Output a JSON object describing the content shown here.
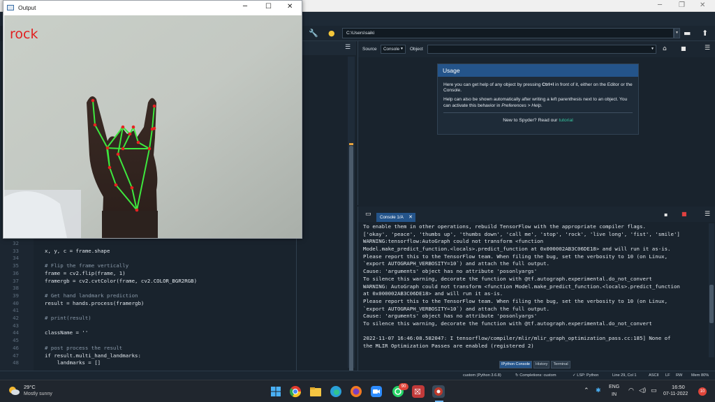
{
  "spyder": {
    "path": "C:\\Users\\saiki",
    "help": {
      "source_label": "Source",
      "source_value": "Console",
      "object_label": "Object",
      "usage_title": "Usage",
      "p1_a": "Here you can get help of any object by pressing ",
      "p1_b": "Ctrl+I",
      "p1_c": " in front of it, either on the Editor or the Console.",
      "p2_a": "Help can also be shown automatically after writing a left parenthesis next to an object. You can activate this behavior in ",
      "p2_b": "Preferences > Help",
      "p2_c": ".",
      "foot_a": "New to Spyder? Read our ",
      "foot_link": "tutorial",
      "tabs": [
        "Help",
        "Variable Explorer",
        "Plots",
        "Files"
      ]
    },
    "console": {
      "tab": "Console 1/A",
      "lines": [
        "To enable them in other operations, rebuild TensorFlow with the appropriate compiler flags.",
        "['okay', 'peace', 'thumbs up', 'thumbs down', 'call me', 'stop', 'rock', 'live long', 'fist', 'smile']",
        "WARNING:tensorflow:AutoGraph could not transform <function",
        "Model.make_predict_function.<locals>.predict_function at 0x000002AB3C06DE18> and will run it as-is.",
        "Please report this to the TensorFlow team. When filing the bug, set the verbosity to 10 (on Linux,",
        "`export AUTOGRAPH_VERBOSITY=10`) and attach the full output.",
        "Cause: 'arguments' object has no attribute 'posonlyargs'",
        "To silence this warning, decorate the function with @tf.autograph.experimental.do_not_convert",
        "WARNING: AutoGraph could not transform <function Model.make_predict_function.<locals>.predict_function",
        "at 0x000002AB3C06DE18> and will run it as-is.",
        "Please report this to the TensorFlow team. When filing the bug, set the verbosity to 10 (on Linux,",
        "`export AUTOGRAPH_VERBOSITY=10`) and attach the full output.",
        "Cause: 'arguments' object has no attribute 'posonlyargs'",
        "To silence this warning, decorate the function with @tf.autograph.experimental.do_not_convert",
        "",
        "2022-11-07 16:46:08.582047: I tensorflow/compiler/mlir/mlir_graph_optimization_pass.cc:185] None of",
        "the MLIR Optimization Passes are enabled (registered 2)"
      ],
      "tabs": [
        "IPython Console",
        "History",
        "Terminal"
      ]
    },
    "editor": {
      "lines": [
        {
          "n": "32",
          "t": "",
          "c": "kw"
        },
        {
          "n": "33",
          "t": "x, y, c = frame.shape",
          "c": "kw"
        },
        {
          "n": "34",
          "t": "",
          "c": "kw"
        },
        {
          "n": "35",
          "t": "# Flip the frame vertically",
          "c": "cm"
        },
        {
          "n": "36",
          "t": "frame = cv2.flip(frame, 1)",
          "c": "kw"
        },
        {
          "n": "37",
          "t": "framergb = cv2.cvtColor(frame, cv2.COLOR_BGR2RGB)",
          "c": "kw"
        },
        {
          "n": "38",
          "t": "",
          "c": "kw"
        },
        {
          "n": "39",
          "t": "# Get hand landmark prediction",
          "c": "cm"
        },
        {
          "n": "40",
          "t": "result = hands.process(framergb)",
          "c": "kw"
        },
        {
          "n": "41",
          "t": "",
          "c": "kw"
        },
        {
          "n": "42",
          "t": "# print(result)",
          "c": "cm"
        },
        {
          "n": "43",
          "t": "",
          "c": "kw"
        },
        {
          "n": "44",
          "t": "className = ''",
          "c": "kw"
        },
        {
          "n": "45",
          "t": "",
          "c": "kw"
        },
        {
          "n": "46",
          "t": "# post process the result",
          "c": "cm"
        },
        {
          "n": "47",
          "t": "if result.multi_hand_landmarks:",
          "c": "kw"
        },
        {
          "n": "48",
          "t": "    landmarks = []",
          "c": "kw"
        }
      ]
    },
    "status": {
      "env": "custom (Python 3.6.8)",
      "completions": "Completions: custom",
      "lsp": "LSP: Python",
      "pos": "Line 29, Col 1",
      "enc": "ASCII",
      "eol": "LF",
      "rw": "RW",
      "mem": "Mem 80%"
    }
  },
  "output_window": {
    "title": "Output",
    "gesture": "rock"
  },
  "taskbar": {
    "temp": "29°C",
    "weather": "Mostly sunny",
    "badge": "90",
    "lang1": "ENG",
    "lang2": "IN",
    "time": "16:50",
    "date": "07-11-2022",
    "notif": "10"
  }
}
